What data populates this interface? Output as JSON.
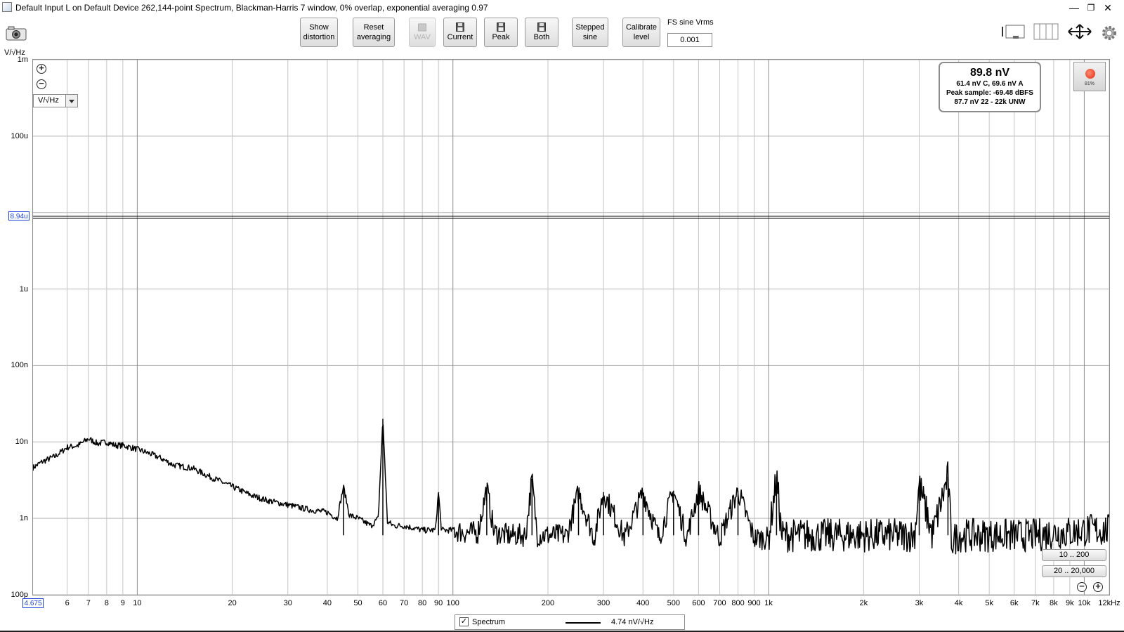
{
  "window": {
    "title": "Default Input L on Default Device 262,144-point Spectrum, Blackman-Harris 7 window, 0% overlap, exponential averaging 0.97",
    "minimize": "—",
    "restore": "❐",
    "close": "✕"
  },
  "toolbar": {
    "show_distortion": "Show\ndistortion",
    "reset_averaging": "Reset\naveraging",
    "wav": "WAV",
    "current": "Current",
    "peak": "Peak",
    "both": "Both",
    "stepped_sine": "Stepped\nsine",
    "calibrate_level": "Calibrate\nlevel",
    "fs_sine_label": "FS sine Vrms",
    "fs_sine_value": "0.001"
  },
  "plot": {
    "y_unit": "V/√Hz",
    "unit_select": "V/√Hz",
    "y_cursor": "8.94u",
    "x_cursor": "4.675",
    "readout": {
      "main": "89.8 nV",
      "line1": "61.4 nV C, 69.6 nV A",
      "line2": "Peak sample: -69.48 dBFS",
      "line3": "87.7 nV 22 - 22k UNW"
    },
    "record_percent": "81%",
    "range_a": "10 .. 200",
    "range_b": "20 .. 20,000",
    "legend": {
      "name": "Spectrum",
      "value": "4.74 nV/√Hz"
    }
  },
  "chart_data": {
    "type": "line",
    "title": "",
    "xlabel": "",
    "ylabel": "V/√Hz",
    "x_scale": "log",
    "y_scale": "log",
    "xlim": [
      4.675,
      12000
    ],
    "ylim": [
      1e-10,
      0.001
    ],
    "y_ticks": [
      {
        "value": 0.001,
        "label": "1m"
      },
      {
        "value": 0.0001,
        "label": "100u"
      },
      {
        "value": 1e-05,
        "label": ""
      },
      {
        "value": 1e-06,
        "label": "1u"
      },
      {
        "value": 1e-07,
        "label": "100n"
      },
      {
        "value": 1e-08,
        "label": "10n"
      },
      {
        "value": 1e-09,
        "label": "1n"
      },
      {
        "value": 1e-10,
        "label": "100p"
      }
    ],
    "x_ticks": [
      {
        "value": 6,
        "label": "6"
      },
      {
        "value": 7,
        "label": "7"
      },
      {
        "value": 8,
        "label": "8"
      },
      {
        "value": 9,
        "label": "9"
      },
      {
        "value": 10,
        "label": "10"
      },
      {
        "value": 20,
        "label": "20"
      },
      {
        "value": 30,
        "label": "30"
      },
      {
        "value": 40,
        "label": "40"
      },
      {
        "value": 50,
        "label": "50"
      },
      {
        "value": 60,
        "label": "60"
      },
      {
        "value": 70,
        "label": "70"
      },
      {
        "value": 80,
        "label": "80"
      },
      {
        "value": 90,
        "label": "90"
      },
      {
        "value": 100,
        "label": "100"
      },
      {
        "value": 200,
        "label": "200"
      },
      {
        "value": 300,
        "label": "300"
      },
      {
        "value": 400,
        "label": "400"
      },
      {
        "value": 500,
        "label": "500"
      },
      {
        "value": 600,
        "label": "600"
      },
      {
        "value": 700,
        "label": "700"
      },
      {
        "value": 800,
        "label": "800"
      },
      {
        "value": 900,
        "label": "900"
      },
      {
        "value": 1000,
        "label": "1k"
      },
      {
        "value": 2000,
        "label": "2k"
      },
      {
        "value": 3000,
        "label": "3k"
      },
      {
        "value": 4000,
        "label": "4k"
      },
      {
        "value": 5000,
        "label": "5k"
      },
      {
        "value": 6000,
        "label": "6k"
      },
      {
        "value": 7000,
        "label": "7k"
      },
      {
        "value": 8000,
        "label": "8k"
      },
      {
        "value": 9000,
        "label": "9k"
      },
      {
        "value": 10000,
        "label": "10k"
      },
      {
        "value": 12000,
        "label": "12kHz"
      }
    ],
    "reference_line": 8.94e-06,
    "series": [
      {
        "name": "Spectrum",
        "color": "#000000",
        "x": [
          4.675,
          5,
          5.5,
          6,
          6.5,
          7,
          7.5,
          8,
          8.5,
          9,
          9.5,
          10,
          11,
          12,
          13,
          15,
          17,
          20,
          23,
          26,
          30,
          35,
          40,
          43,
          45,
          47,
          50,
          55,
          58,
          60,
          62,
          65,
          70,
          80,
          88,
          90,
          92,
          100,
          110,
          120,
          128,
          135,
          150,
          170,
          178,
          185,
          200,
          230,
          250,
          280,
          300,
          350,
          400,
          450,
          500,
          550,
          600,
          700,
          800,
          900,
          1000,
          1060,
          1100,
          1300,
          1500,
          2000,
          2500,
          2900,
          3000,
          3300,
          3700,
          3800,
          4000,
          5000,
          6000,
          7000,
          8000,
          9000,
          10000,
          11000,
          12000
        ],
        "y": [
          4.6e-09,
          5.5e-09,
          6.5e-09,
          8.5e-09,
          9e-09,
          1.1e-08,
          9.5e-09,
          1e-08,
          9e-09,
          9e-09,
          8.5e-09,
          8e-09,
          7e-09,
          6e-09,
          5e-09,
          4.5e-09,
          3.5e-09,
          2.6e-09,
          2e-09,
          1.7e-09,
          1.5e-09,
          1.3e-09,
          1.2e-09,
          1e-09,
          2.6e-09,
          1.1e-09,
          1e-09,
          8e-10,
          1e-09,
          2e-08,
          9e-10,
          8e-10,
          8e-10,
          7e-10,
          7e-10,
          2.2e-09,
          7e-10,
          7e-10,
          6.5e-10,
          6.5e-10,
          2.5e-09,
          6.5e-10,
          6e-10,
          6e-10,
          3.3e-09,
          6e-10,
          6e-10,
          6e-10,
          2.2e-09,
          5.5e-10,
          2.2e-09,
          5.5e-10,
          2.2e-09,
          5.5e-10,
          2.3e-09,
          5.5e-10,
          2.3e-09,
          5.5e-10,
          2.3e-09,
          5.5e-10,
          5.5e-10,
          3.5e-09,
          6e-10,
          6e-10,
          6e-10,
          6e-10,
          6e-10,
          6e-10,
          2.8e-09,
          6e-10,
          3.5e-09,
          5e-10,
          6e-10,
          6e-10,
          6e-10,
          6e-10,
          6.5e-10,
          6.5e-10,
          7e-10,
          7e-10,
          7e-10
        ]
      }
    ]
  }
}
